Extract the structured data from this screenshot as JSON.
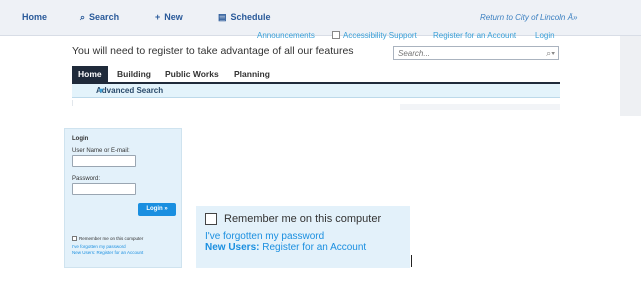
{
  "topnav": {
    "home": "Home",
    "search": "Search",
    "new": "New",
    "schedule": "Schedule",
    "return": "Return to City of Lincoln",
    "return_glyph": "Ä»",
    "search_icon": "⌕",
    "new_icon": "+",
    "schedule_icon": "▤"
  },
  "utility": {
    "announcements": "Announcements",
    "accessibility": "Accessibility Support",
    "register": "Register for an Account",
    "login": "Login"
  },
  "intro_text": "You will need to register to take advantage of all our features",
  "search": {
    "placeholder": "Search...",
    "button_icon": "⌕▾"
  },
  "tabs": [
    {
      "label": "Home",
      "active": true
    },
    {
      "label": "Building",
      "active": false
    },
    {
      "label": "Public Works",
      "active": false
    },
    {
      "label": "Planning",
      "active": false
    }
  ],
  "advanced_search": {
    "label": "Advanced Search",
    "caret": "▾"
  },
  "login_panel": {
    "title": "Login",
    "username_label": "User Name or E-mail:",
    "password_label": "Password:",
    "button": "Login »",
    "remember": "Remember me on this computer",
    "forgot": "I've forgotten my password",
    "new_users_prefix": "New Users:",
    "new_users_link": "Register for an Account"
  },
  "inset": {
    "remember": "Remember me on this computer",
    "forgot": "I've forgotten my password",
    "new_users_prefix": "New Users:",
    "new_users_link": "Register for an Account"
  },
  "colors": {
    "link": "#3aa0d8",
    "accent_blue": "#1a8fe0",
    "tab_active": "#1f2a3a",
    "panel_bg": "#e3f1fa"
  }
}
